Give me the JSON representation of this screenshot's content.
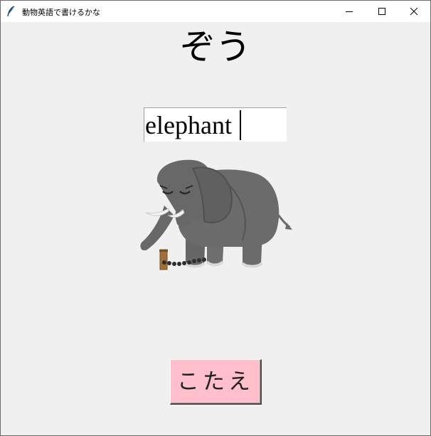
{
  "window": {
    "title": "動物英語で書けるかな",
    "controls": [
      "minimize-icon",
      "maximize-icon",
      "close-icon"
    ]
  },
  "main": {
    "heading": "ぞう",
    "answer_input_value": "elephant",
    "image_icon": "elephant-illustration",
    "answer_button_label": "こたえ"
  },
  "colors": {
    "background": "#f0f0f0",
    "button": "#ffc0cb",
    "input_background": "#ffffff",
    "elephant_body": "#6b6b6b"
  }
}
